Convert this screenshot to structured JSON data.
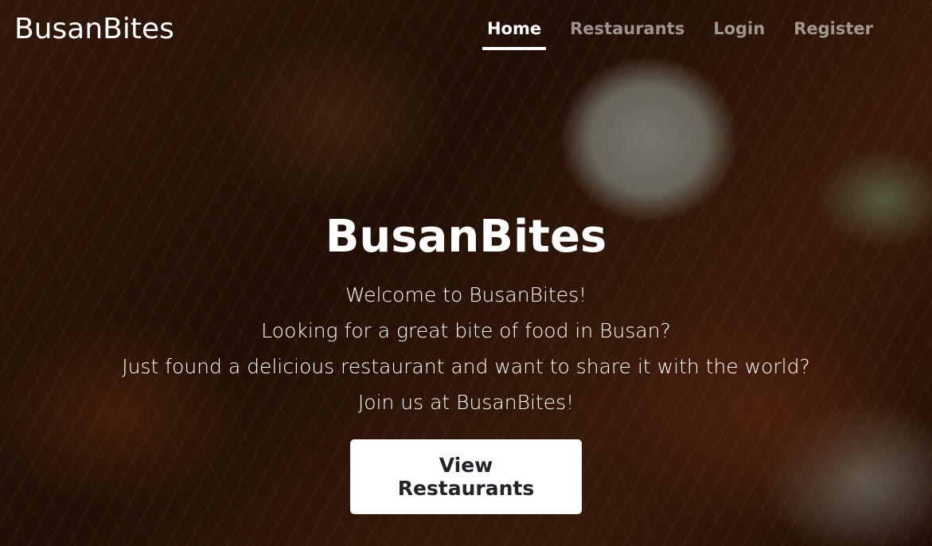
{
  "navbar": {
    "brand": "BusanBites",
    "links": [
      {
        "label": "Home",
        "active": true
      },
      {
        "label": "Restaurants",
        "active": false
      },
      {
        "label": "Login",
        "active": false
      },
      {
        "label": "Register",
        "active": false
      }
    ]
  },
  "hero": {
    "title": "BusanBites",
    "lines": [
      "Welcome to BusanBites!",
      "Looking for a great bite of food in Busan?",
      "Just found a delicious restaurant and want to share it with the world?",
      "Join us at BusanBites!"
    ],
    "cta_label": "View Restaurants",
    "background_image": "food-photo"
  },
  "colors": {
    "nav_active": "#ffffff",
    "nav_inactive": "#8c8c8c",
    "button_bg": "#ffffff",
    "button_text": "#212529"
  }
}
